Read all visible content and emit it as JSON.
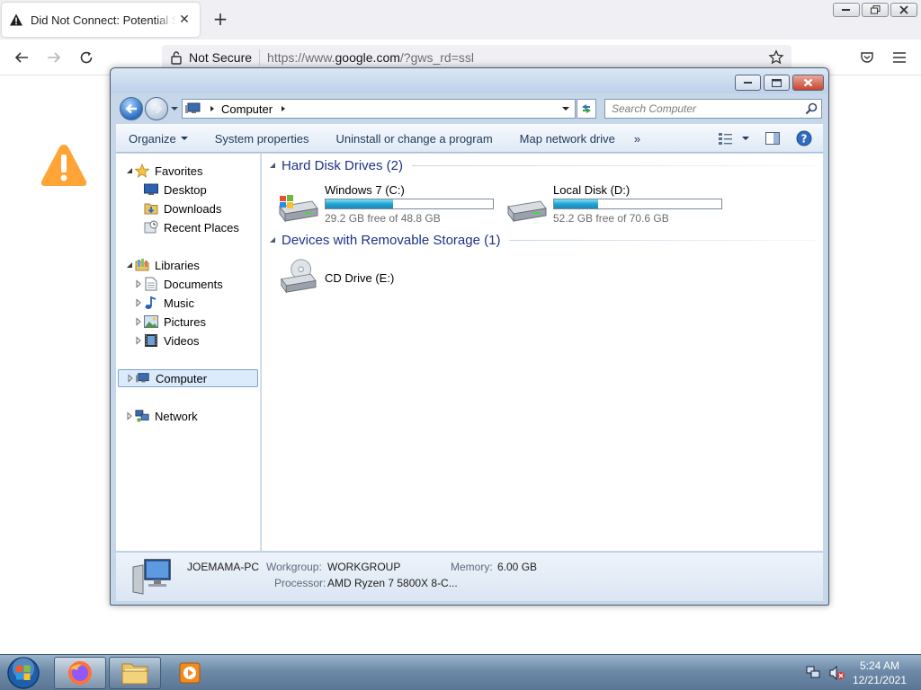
{
  "browser": {
    "tab_title": "Did Not Connect: Potential Security Issue",
    "security_label": "Not Secure",
    "url_prefix": "https://www.",
    "url_domain": "google.com",
    "url_suffix": "/?gws_rd=ssl"
  },
  "explorer": {
    "address_location": "Computer",
    "search_placeholder": "Search Computer",
    "toolbar": {
      "organize": "Organize",
      "system_properties": "System properties",
      "uninstall": "Uninstall or change a program",
      "map_drive": "Map network drive",
      "more": "»"
    },
    "nav": {
      "favorites": "Favorites",
      "desktop": "Desktop",
      "downloads": "Downloads",
      "recent_places": "Recent Places",
      "libraries": "Libraries",
      "documents": "Documents",
      "music": "Music",
      "pictures": "Pictures",
      "videos": "Videos",
      "computer": "Computer",
      "network": "Network"
    },
    "groups": {
      "hard_disks": "Hard Disk Drives (2)",
      "removable": "Devices with Removable Storage (1)"
    },
    "drives": [
      {
        "name": "Windows 7 (C:)",
        "free_text": "29.2 GB free of 48.8 GB",
        "used_fraction": 0.402
      },
      {
        "name": "Local Disk (D:)",
        "free_text": "52.2 GB free of 70.6 GB",
        "used_fraction": 0.261
      }
    ],
    "cd_drive": "CD Drive (E:)",
    "details": {
      "computer_name": "JOEMAMA-PC",
      "workgroup_label": "Workgroup:",
      "workgroup_value": "WORKGROUP",
      "memory_label": "Memory:",
      "memory_value": "6.00 GB",
      "processor_label": "Processor:",
      "processor_value": "AMD Ryzen 7 5800X 8-C..."
    }
  },
  "taskbar": {
    "time": "5:24 AM",
    "date": "12/21/2021"
  }
}
